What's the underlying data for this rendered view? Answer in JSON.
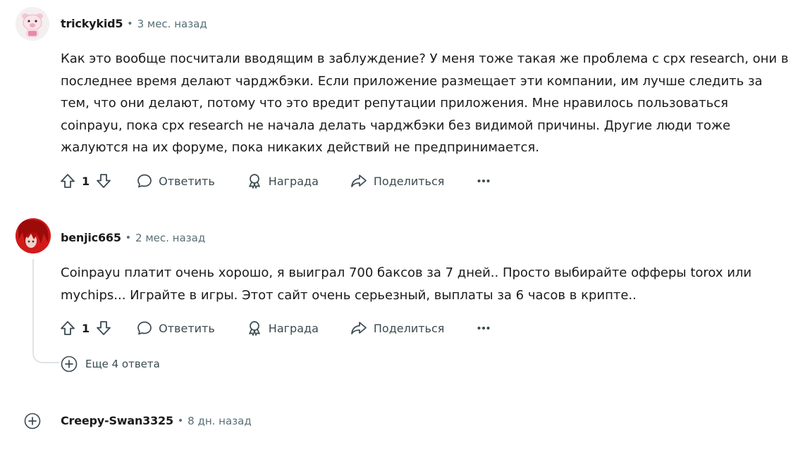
{
  "comments": [
    {
      "username": "trickykid5",
      "separator": "•",
      "time": "3 мес. назад",
      "text": "Как это вообще посчитали вводящим в заблуждение? У меня тоже такая же проблема с cpx research, они в последнее время делают чарджбэки. Если приложение размещает эти компании, им лучше следить за тем, что они делают, потому что это вредит репутации приложения. Мне нравилось пользоваться coinpayu, пока cpx research не начала делать чарджбэки без видимой причины. Другие люди тоже жалуются на их форуме, пока никаких действий не предпринимается.",
      "avatar_icon": "pig-snoo-avatar",
      "votes": "1",
      "reply_label": "Ответить",
      "award_label": "Награда",
      "share_label": "Поделиться",
      "more_icon": "ellipsis-icon"
    },
    {
      "username": "benjic665",
      "separator": "•",
      "time": "2 мес. назад",
      "text": "Coinpayu платит очень хорошо, я выиграл 700 баксов за 7 дней.. Просто выбирайте офферы torox или mychips... Играйте в игры. Этот сайт очень серьезный, выплаты за 6 часов в крипте..",
      "avatar_icon": "red-hair-avatar",
      "votes": "1",
      "reply_label": "Ответить",
      "award_label": "Награда",
      "share_label": "Поделиться",
      "more_icon": "ellipsis-icon",
      "more_replies_label": "Еще 4 ответа"
    },
    {
      "username": "Creepy-Swan3325",
      "separator": "•",
      "time": "8 дн. назад",
      "collapsed": true
    }
  ],
  "colors": {
    "text": "#1a1a1b",
    "meta": "#576f76",
    "icon": "#3a4a50",
    "thread_line": "#e0e3e5"
  }
}
